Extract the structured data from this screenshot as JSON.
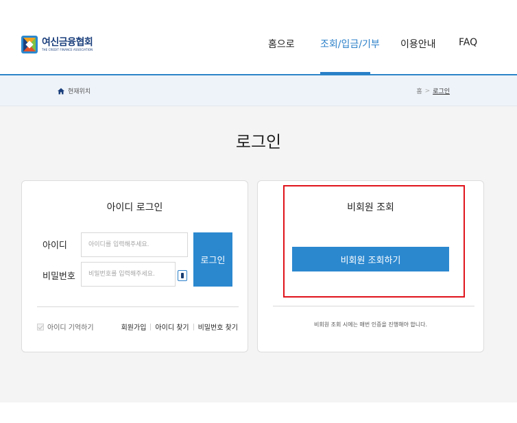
{
  "header": {
    "logo_title": "여신금융협회",
    "logo_subtitle": "THE CREDIT FINANCE ASSOCIATION",
    "nav": [
      "홈으로",
      "조회/입금/기부",
      "이용안내",
      "FAQ"
    ],
    "active_nav": "조회/입금/기부"
  },
  "breadcrumb": {
    "location_label": "현재위치",
    "home": "홈",
    "separator": ">",
    "current": "로그인"
  },
  "page": {
    "title": "로그인"
  },
  "id_login": {
    "title": "아이디 로그인",
    "id_label": "아이디",
    "id_placeholder": "아이디를 입력해주세요.",
    "pw_label": "비밀번호",
    "pw_placeholder": "비밀번호를 입력해주세요.",
    "login_button": "로그인",
    "remember_label": "아이디 기억하기",
    "links": [
      "회원가입",
      "아이디 찾기",
      "비밀번호 찾기"
    ]
  },
  "guest": {
    "title": "비회원 조회",
    "button": "비회원 조회하기",
    "note": "비회원 조회 시에는 매번 인증을 진행해야 합니다."
  },
  "colors": {
    "brand_blue": "#2b88cf",
    "nav_active": "#2a7fc8",
    "highlight_red": "#e0121a"
  }
}
